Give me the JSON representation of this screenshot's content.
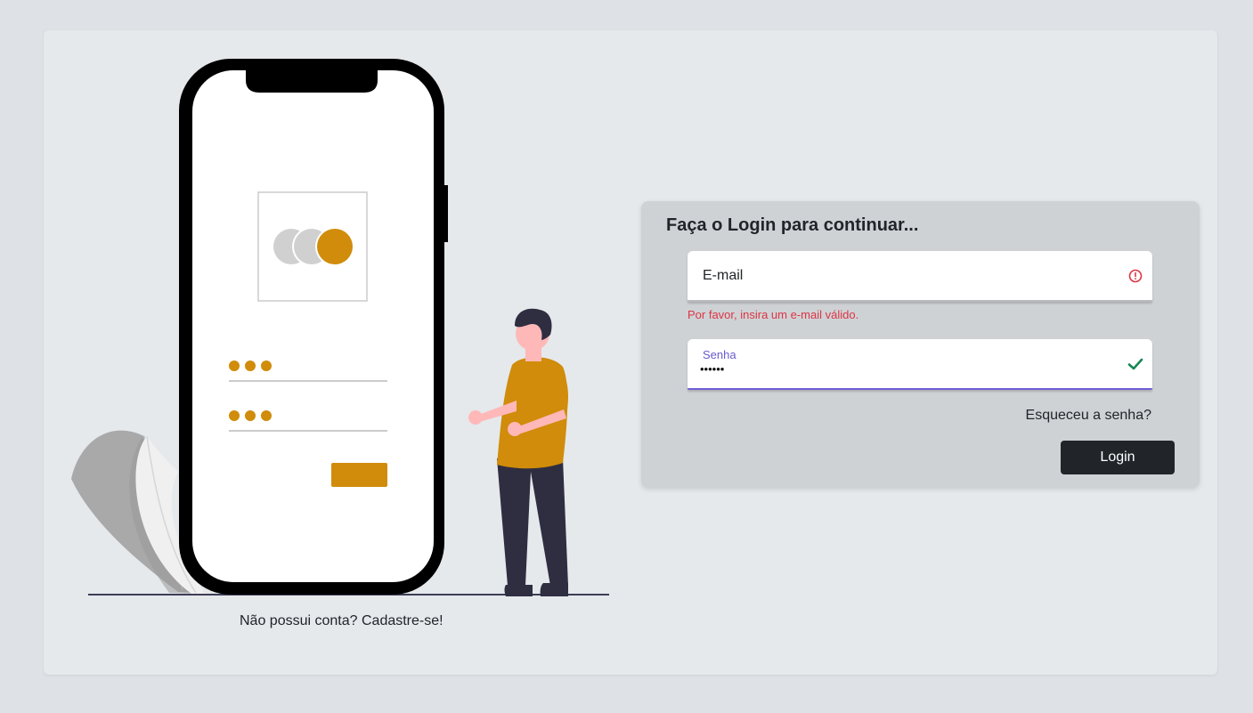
{
  "colors": {
    "page_background": "#dee2e6",
    "card_background": "#e5e9ec",
    "panel_background": "#cfd2d5",
    "accent_gold": "#d08c0a",
    "error_red": "#dc3545",
    "success_green": "#198754",
    "focus_purple": "#6f5fd6",
    "button_dark": "#212529"
  },
  "illustration": {
    "icons": [
      "phone-icon",
      "person-icon",
      "leaf-icon"
    ]
  },
  "signup": {
    "prompt": "Não possui conta?",
    "link_label": "Cadastre-se!"
  },
  "login": {
    "title": "Faça o Login para continuar...",
    "email": {
      "label": "E-mail",
      "value": "",
      "error": "Por favor, insira um e-mail válido.",
      "status_icon": "alert-circle-icon"
    },
    "password": {
      "label": "Senha",
      "value": "••••••",
      "status_icon": "check-icon"
    },
    "forgot_label": "Esqueceu a senha?",
    "submit_label": "Login"
  }
}
